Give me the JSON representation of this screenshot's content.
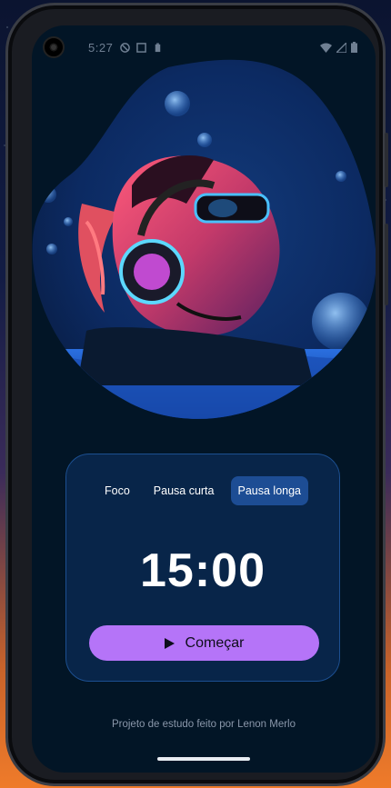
{
  "status_bar": {
    "time": "5:27",
    "icons_left": [
      "do-not-disturb-icon",
      "screenshot-icon",
      "battery-saver-icon"
    ],
    "icons_right": [
      "wifi-icon",
      "signal-icon",
      "battery-icon"
    ]
  },
  "hero": {
    "image": "woman-with-headphones-underwater-illustration"
  },
  "timer_card": {
    "tabs": [
      {
        "label": "Foco",
        "active": false
      },
      {
        "label": "Pausa curta",
        "active": false
      },
      {
        "label": "Pausa longa",
        "active": true
      }
    ],
    "time_display": "15:00",
    "start_button": {
      "label": "Começar",
      "icon": "play-icon"
    }
  },
  "footer": {
    "credit": "Projeto de estudo feito por Lenon Merlo"
  },
  "colors": {
    "background": "#021526",
    "card_border": "#1c4f90",
    "active_tab": "#1d4d94",
    "accent_button": "#b574f8"
  }
}
